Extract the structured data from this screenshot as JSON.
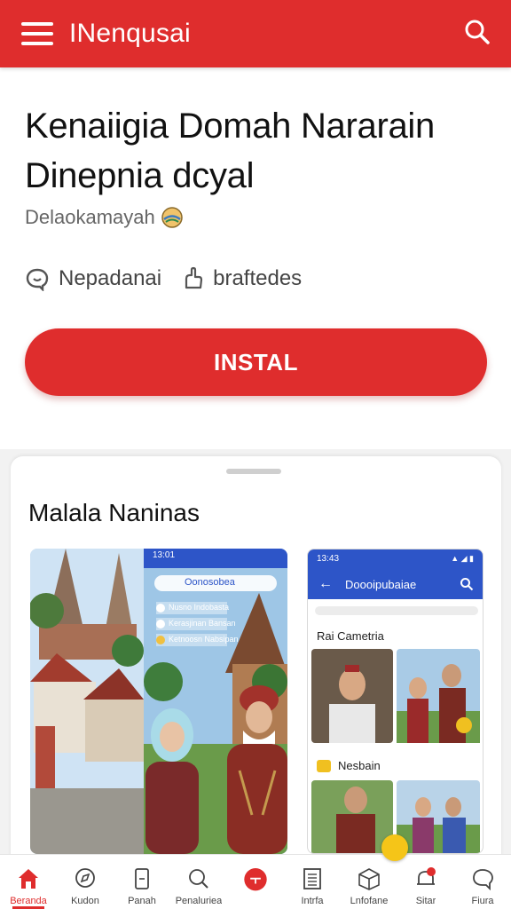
{
  "appbar": {
    "title": "INenqusai",
    "menu_icon": "menu-icon",
    "search_icon": "search-icon",
    "color": "#df2d2d"
  },
  "app": {
    "name": "Kenaiigia Domah Nararain Dinepnia dcyal",
    "developer": "Delaokamayah",
    "developer_badge": "globe-badge-icon",
    "meta": [
      {
        "icon": "chat-icon",
        "label": "Nepadanai"
      },
      {
        "icon": "hand-icon",
        "label": "braftedes"
      }
    ],
    "install_label": "INSTAL"
  },
  "screenshots": {
    "title": "Malala Naninas",
    "shot1": {
      "time": "13:01",
      "search_text": "Oonosobea",
      "list": [
        "Nusno Indobasta",
        "Kerasjinan Bansan",
        "Ketnoosn Nabsipan"
      ]
    },
    "shot2": {
      "time": "13:43",
      "header": "Doooipubaiae",
      "section1": "Rai Cametria",
      "section2": "Nesbain"
    }
  },
  "bottom_nav": [
    {
      "icon": "home-icon",
      "label": "Beranda",
      "active": true
    },
    {
      "icon": "compass-icon",
      "label": "Kudon"
    },
    {
      "icon": "bookmark-icon",
      "label": "Panah"
    },
    {
      "icon": "search-icon",
      "label": "Penaluriea"
    },
    {
      "icon": "record-icon",
      "label": ""
    },
    {
      "icon": "document-icon",
      "label": "Intrfa"
    },
    {
      "icon": "box-icon",
      "label": "Lnfofane"
    },
    {
      "icon": "bell-icon",
      "label": "Sitar"
    },
    {
      "icon": "chat-icon",
      "label": "Fiura"
    }
  ]
}
